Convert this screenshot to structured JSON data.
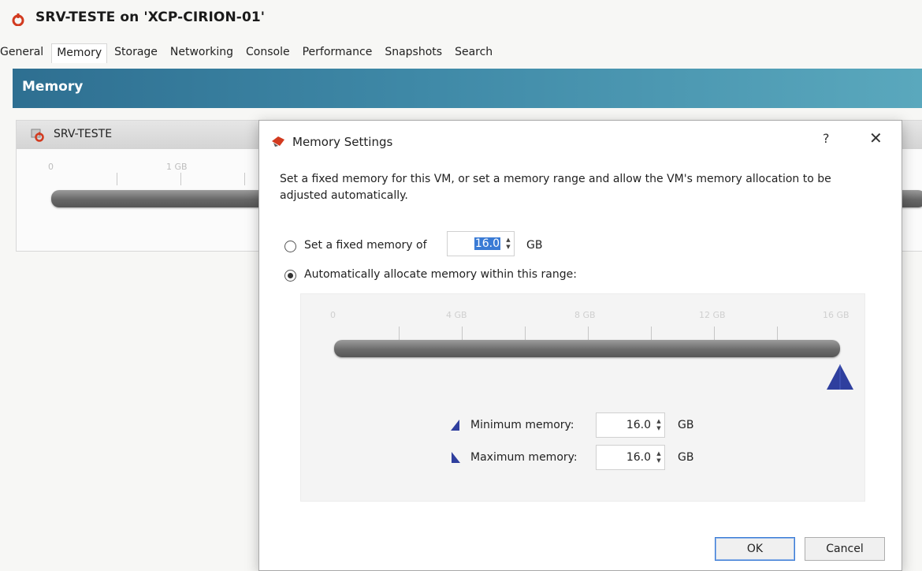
{
  "window": {
    "title": "SRV-TESTE on 'XCP-CIRION-01'"
  },
  "tabs": [
    {
      "label": "General"
    },
    {
      "label": "Memory"
    },
    {
      "label": "Storage"
    },
    {
      "label": "Networking"
    },
    {
      "label": "Console"
    },
    {
      "label": "Performance"
    },
    {
      "label": "Snapshots"
    },
    {
      "label": "Search"
    }
  ],
  "section": {
    "title": "Memory"
  },
  "vm_panel": {
    "name": "SRV-TESTE",
    "ticks": [
      "0",
      "1 GB"
    ]
  },
  "dialog": {
    "title": "Memory Settings",
    "help": "?",
    "close": "✕",
    "description": "Set a fixed memory for this VM, or set a memory range and allow the VM's memory allocation to be adjusted automatically.",
    "fixed_option": {
      "label": "Set a fixed memory of",
      "value": "16.0",
      "unit": "GB",
      "selected": false
    },
    "auto_option": {
      "label": "Automatically allocate memory within this range:",
      "selected": true
    },
    "range": {
      "ticks": [
        "0",
        "4 GB",
        "8 GB",
        "12 GB",
        "16 GB"
      ],
      "min_gb": 16.0,
      "max_gb": 16.0,
      "scale_max_gb": 16
    },
    "minimum": {
      "label": "Minimum memory:",
      "value": "16.0",
      "unit": "GB"
    },
    "maximum": {
      "label": "Maximum memory:",
      "value": "16.0",
      "unit": "GB"
    },
    "ok_label": "OK",
    "cancel_label": "Cancel"
  },
  "colors": {
    "accent": "#2f3f9e",
    "header_start": "#2e6f91",
    "header_end": "#5aa8bd",
    "selection": "#3a7bd5"
  }
}
